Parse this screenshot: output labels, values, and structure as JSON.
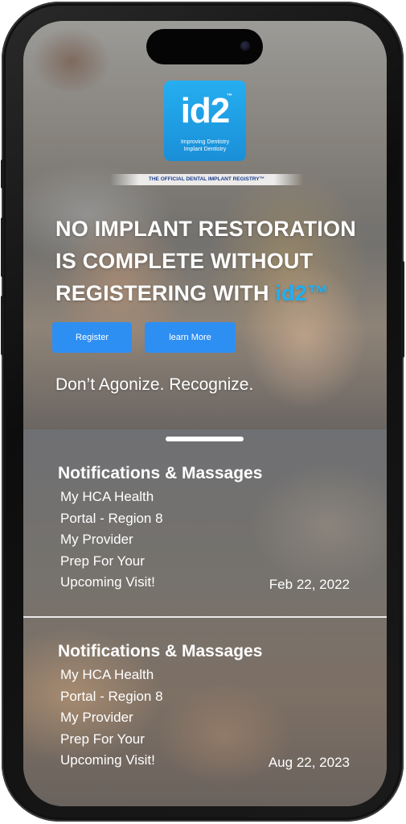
{
  "logo": {
    "text": "id2",
    "tm": "™",
    "tagline_line1": "Improving Dentistry",
    "tagline_line2": "Implant Dentistry",
    "brand_color": "#1fa4ea"
  },
  "registry_banner": "THE OFFICIAL DENTAL IMPLANT REGISTRY™",
  "hero": {
    "headline_line1": "NO IMPLANT RESTORATION",
    "headline_line2": "IS COMPLETE WITHOUT",
    "headline_line3_prefix": "REGISTERING WITH ",
    "headline_brand": "id2™",
    "brand_color": "#1fb0f5",
    "register_label": "Register",
    "learn_more_label": "learn More",
    "tagline": "Don’t Agonize. Recognize.",
    "button_color": "#2e8ff3"
  },
  "notifications": [
    {
      "title": "Notifications & Massages",
      "lines": [
        "My HCA Health",
        "Portal - Region 8",
        "My Provider",
        "Prep For Your",
        "Upcoming Visit!"
      ],
      "date": "Feb 22, 2022"
    },
    {
      "title": "Notifications & Massages",
      "lines": [
        "My HCA Health",
        "Portal - Region 8",
        "My Provider",
        "Prep For Your",
        "Upcoming Visit!"
      ],
      "date": "Aug 22, 2023"
    }
  ]
}
